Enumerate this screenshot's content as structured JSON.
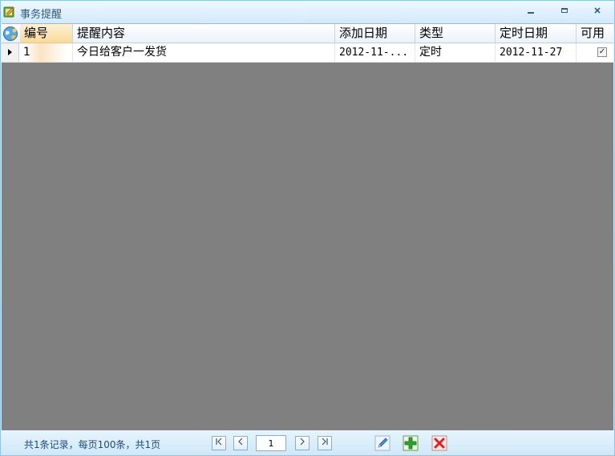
{
  "window": {
    "title": "事务提醒",
    "minimize_icon": "minimize-icon",
    "maximize_icon": "maximize-icon",
    "close_icon": "close-icon"
  },
  "grid": {
    "columns": [
      "编号",
      "提醒内容",
      "添加日期",
      "类型",
      "定时日期",
      "可用"
    ],
    "rows": [
      {
        "id": "1",
        "content": "今日给客户一发货",
        "add_date": "2012-11-...",
        "type": "定时",
        "timed_date": "2012-11-27",
        "enabled": true
      }
    ]
  },
  "statusbar": {
    "summary": "共1条记录，每页100条，共1页",
    "current_page": "1",
    "first_icon": "first-page-icon",
    "prev_icon": "prev-page-icon",
    "next_icon": "next-page-icon",
    "last_icon": "last-page-icon",
    "edit_icon": "pencil-icon",
    "add_icon": "add-icon",
    "delete_icon": "delete-icon"
  },
  "colors": {
    "header_active": "#f9d99a",
    "grid_background": "#808080",
    "frame": "#cfe8f8"
  }
}
